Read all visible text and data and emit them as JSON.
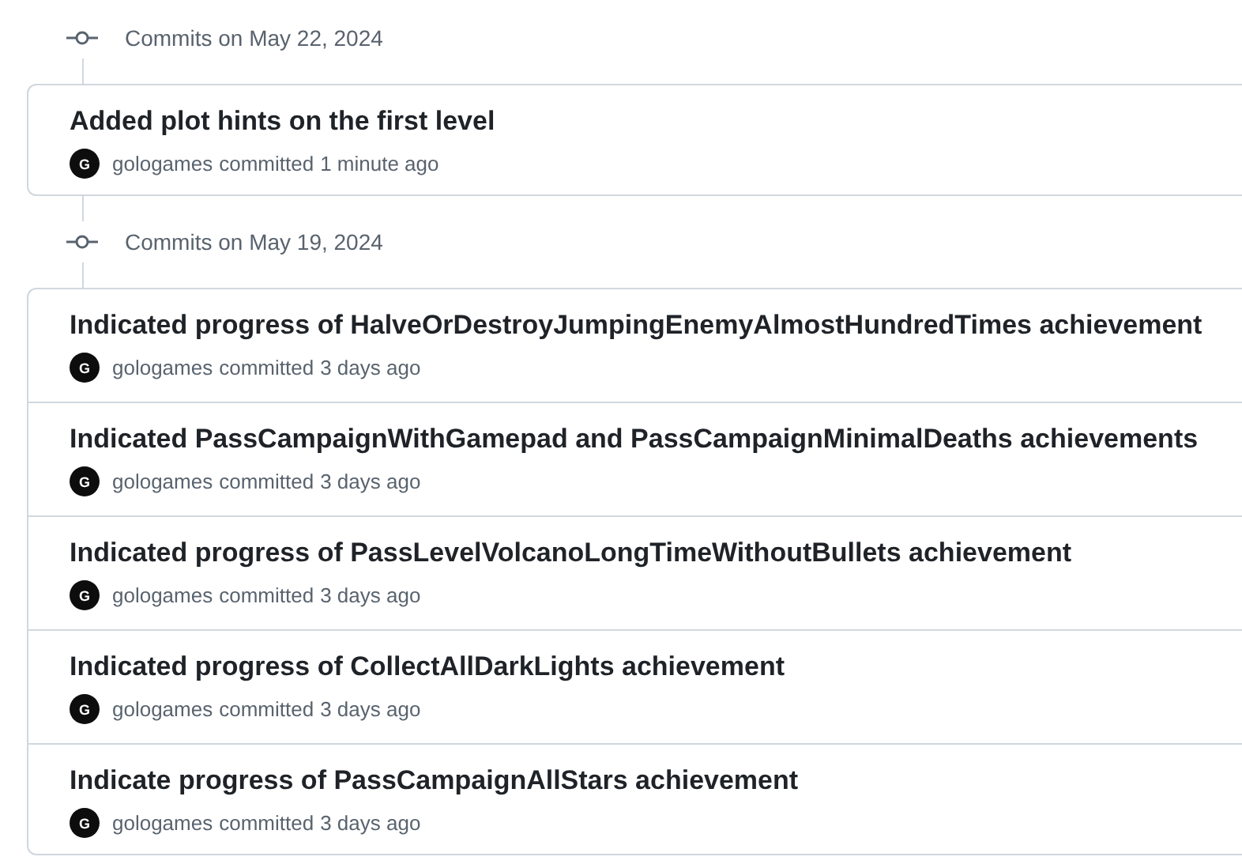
{
  "groups": [
    {
      "date": "Commits on May 22, 2024",
      "commits": [
        {
          "title": "Added plot hints on the first level",
          "avatar": "G",
          "author": "gologames",
          "action": "committed",
          "time": "1 minute ago"
        }
      ]
    },
    {
      "date": "Commits on May 19, 2024",
      "commits": [
        {
          "title": "Indicated progress of HalveOrDestroyJumpingEnemyAlmostHundredTimes achievement",
          "avatar": "G",
          "author": "gologames",
          "action": "committed",
          "time": "3 days ago"
        },
        {
          "title": "Indicated PassCampaignWithGamepad and PassCampaignMinimalDeaths achievements",
          "avatar": "G",
          "author": "gologames",
          "action": "committed",
          "time": "3 days ago"
        },
        {
          "title": "Indicated progress of PassLevelVolcanoLongTimeWithoutBullets achievement",
          "avatar": "G",
          "author": "gologames",
          "action": "committed",
          "time": "3 days ago"
        },
        {
          "title": "Indicated progress of CollectAllDarkLights achievement",
          "avatar": "G",
          "author": "gologames",
          "action": "committed",
          "time": "3 days ago"
        },
        {
          "title": "Indicate progress of PassCampaignAllStars achievement",
          "avatar": "G",
          "author": "gologames",
          "action": "committed",
          "time": "3 days ago"
        }
      ]
    }
  ]
}
